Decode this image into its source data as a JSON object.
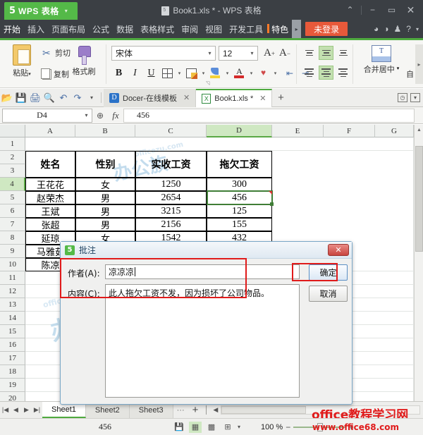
{
  "titlebar": {
    "wps_tab": "WPS 表格",
    "wps_logo": "5",
    "caret": "▾",
    "document_title": "Book1.xls * - WPS 表格",
    "win_collapse": "⌃",
    "win_minimize": "−",
    "win_maximize": "▭",
    "win_close": "✕"
  },
  "menubar": {
    "items": [
      {
        "label": "开始",
        "active": true
      },
      {
        "label": "插入",
        "active": false
      },
      {
        "label": "页面布局",
        "active": false
      },
      {
        "label": "公式",
        "active": false
      },
      {
        "label": "数据",
        "active": false
      },
      {
        "label": "表格样式",
        "active": false
      },
      {
        "label": "审阅",
        "active": false
      },
      {
        "label": "视图",
        "active": false
      },
      {
        "label": "开发工具",
        "active": false
      },
      {
        "label": "特色",
        "active": false
      }
    ],
    "overflow_arrow": "▸",
    "login_label": "未登录",
    "right_icons": [
      "◕",
      "◑",
      "♟",
      "?"
    ],
    "help_caret": "▾"
  },
  "ribbon": {
    "paste_label": "粘贴",
    "paste_caret": "▾",
    "cut_label": "剪切",
    "cut_icon": "✂",
    "copy_label": "复制",
    "format_painter_label": "格式刷",
    "font_name": "宋体",
    "font_size": "12",
    "combo_caret": "▾",
    "grow_font": "A",
    "grow_sup": "+",
    "shrink_font": "A",
    "shrink_sup": "−",
    "bold": "B",
    "italic": "I",
    "underline": "U",
    "border_caret": "▾",
    "borderstyle_caret": "▾",
    "fill_caret": "▾",
    "fontcolor": "A",
    "fontcolor_caret": "▾",
    "heart_icon": "♥",
    "heart_caret": "▾",
    "indent_dec": "⇤",
    "indent_inc": "⇥",
    "merge_label": "合并居中",
    "merge_caret": "▾",
    "autowrap_label": "自",
    "scroll_arrow": "▸",
    "dlg_launcher": "◹"
  },
  "quickaccess": {
    "icons": [
      "📂",
      "💾",
      "🖨",
      "🔍",
      "↶",
      "↷"
    ],
    "caret": "▾",
    "doc_tabs": [
      {
        "label": "Docer-在线模板",
        "icon": "D",
        "active": false,
        "close": "✕"
      },
      {
        "label": "Book1.xls *",
        "icon": "X",
        "active": true,
        "close": "✕"
      }
    ],
    "new_tab": "+",
    "right_icons": [
      "🕘",
      "⊞"
    ]
  },
  "formulabar": {
    "name_box": "D4",
    "name_caret": "▾",
    "zoom_icon": "⊕",
    "fx_icon": "fx",
    "formula_value": "456"
  },
  "sheet": {
    "column_headers": [
      "A",
      "B",
      "C",
      "D",
      "E",
      "F",
      "G"
    ],
    "selected_column": "D",
    "row_headers": [
      "1",
      "2",
      "3",
      "4",
      "5",
      "6",
      "7",
      "8",
      "9",
      "10",
      "11",
      "12",
      "13",
      "14",
      "15",
      "16",
      "17",
      "18",
      "19",
      "20"
    ],
    "selected_row": "4",
    "table": {
      "headers": [
        "姓名",
        "性别",
        "实收工资",
        "拖欠工资"
      ],
      "rows": [
        {
          "name": "王花花",
          "gender": "女",
          "paid": "1250",
          "owed": "300"
        },
        {
          "name": "赵荣杰",
          "gender": "男",
          "paid": "2654",
          "owed": "456"
        },
        {
          "name": "王斌",
          "gender": "男",
          "paid": "3215",
          "owed": "125"
        },
        {
          "name": "张超",
          "gender": "男",
          "paid": "2156",
          "owed": "155"
        },
        {
          "name": "延琼",
          "gender": "女",
          "paid": "1542",
          "owed": "432"
        },
        {
          "name": "马雅茹",
          "gender": "",
          "paid": "",
          "owed": ""
        },
        {
          "name": "陈凉",
          "gender": "",
          "paid": "",
          "owed": ""
        }
      ]
    },
    "scroll_up": "▲",
    "scroll_down": "▼"
  },
  "watermarks": {
    "blue_text": "office教程",
    "red_title": "office教程学习网",
    "red_url": "www.office68.com"
  },
  "dialog": {
    "title": "批注",
    "icon_letter": "5",
    "close_label": "✕",
    "author_label": "作者(A):",
    "author_value": "凉凉凉",
    "content_label": "内容(C):",
    "content_value": "此人拖欠工资不发，因为损坏了公司物品。",
    "ok_label": "确定",
    "cancel_label": "取消",
    "highlight_color": "#e01b1b"
  },
  "sheettabs": {
    "nav_first": "|◀",
    "nav_prev": "◀",
    "nav_next": "▶",
    "nav_last": "▶|",
    "tabs": [
      {
        "label": "Sheet1",
        "active": true
      },
      {
        "label": "Sheet2",
        "active": false
      },
      {
        "label": "Sheet3",
        "active": false
      }
    ],
    "more": "···",
    "add": "+",
    "hscroll_left": "◀"
  },
  "statusbar": {
    "value": "456",
    "save_icon": "💾",
    "view_normal": "▦",
    "view_layout": "▩",
    "view_break": "⊞",
    "view_caret": "▾",
    "zoom_level": "100 %",
    "zoom_out": "−",
    "zoom_in": "+"
  }
}
